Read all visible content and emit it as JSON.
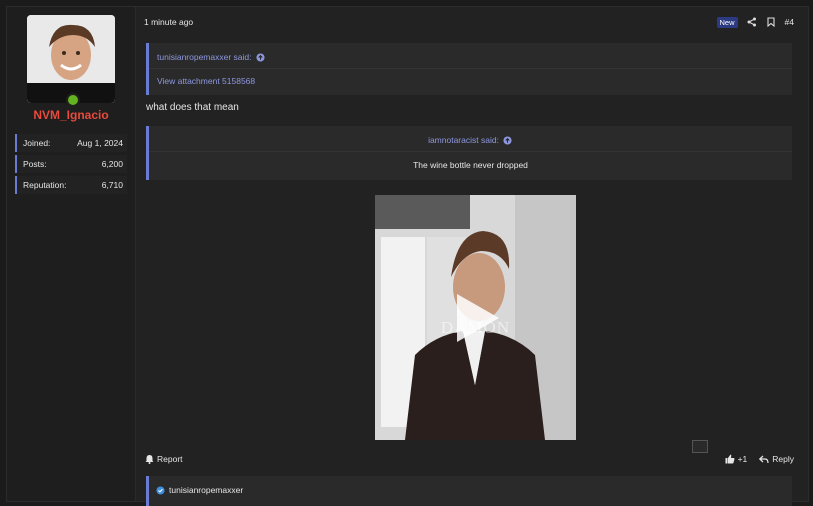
{
  "user": {
    "name": "NVM_Ignacio",
    "stats": [
      {
        "label": "Joined:",
        "value": "Aug 1, 2024"
      },
      {
        "label": "Posts:",
        "value": "6,200"
      },
      {
        "label": "Reputation:",
        "value": "6,710"
      }
    ]
  },
  "post": {
    "time": "1 minute ago",
    "badge": "New",
    "number": "#4",
    "quote1": {
      "author": "tunisianropemaxxer said:",
      "link": "View attachment 5158568"
    },
    "text": "what does that mean",
    "quote2": {
      "author": "iamnotaracist said:",
      "text": "The wine bottle never dropped"
    },
    "video": {
      "watermark": "DAMON"
    },
    "footer": {
      "report": "Report",
      "like": "+1",
      "reply": "Reply"
    },
    "quote3": {
      "author": "tunisianropemaxxer"
    }
  },
  "colors": {
    "accent": "#6a7bd4",
    "username": "#e84a3c",
    "online": "#63b320",
    "badge": "#2b3a82"
  }
}
